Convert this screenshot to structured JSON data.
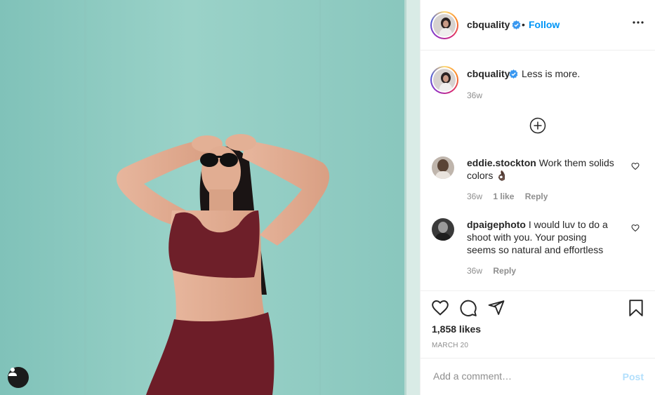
{
  "post": {
    "author": {
      "username": "cbquality",
      "verified": true,
      "follow_label": "Follow",
      "separator": "•"
    },
    "more_icon": "more-horizontal-icon",
    "caption": {
      "username": "cbquality",
      "text": "Less is more.",
      "age": "36w"
    },
    "load_more_icon": "plus-circle-icon",
    "comments": [
      {
        "username": "eddie.stockton",
        "text": "Work them solids colors 👌🏿",
        "age": "36w",
        "likes": "1 like",
        "reply": "Reply"
      },
      {
        "username": "dpaigephoto",
        "text": "I would luv to do a shoot with you. Your posing seems so natural and effortless",
        "age": "36w",
        "reply": "Reply"
      }
    ],
    "likes": "1,858 likes",
    "date": "MARCH 20",
    "comment_placeholder": "Add a comment…",
    "post_label": "Post",
    "icons": [
      "heart-icon",
      "comment-icon",
      "share-icon",
      "bookmark-icon",
      "user-tag-icon"
    ],
    "colors": {
      "link": "#0095f6",
      "verified": "#3897f0",
      "muted": "#8e8e8e",
      "post_disabled": "#b2dffc"
    }
  }
}
